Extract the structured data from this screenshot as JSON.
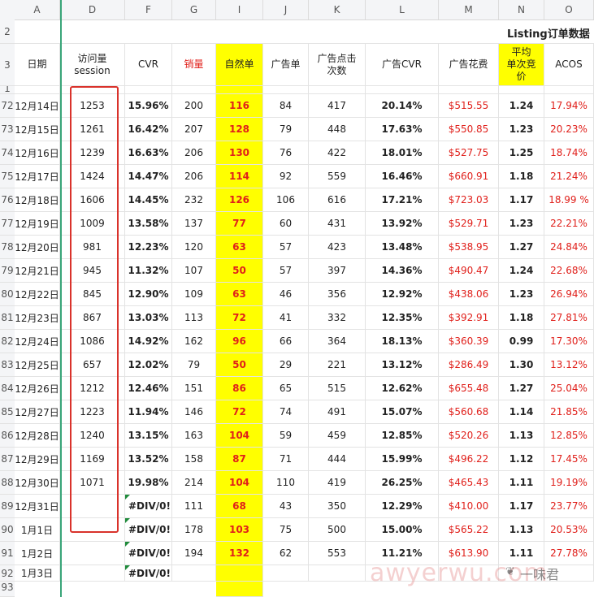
{
  "columns": [
    "A",
    "D",
    "F",
    "G",
    "I",
    "J",
    "K",
    "L",
    "M",
    "N",
    "O"
  ],
  "title_row": {
    "row_no": "2",
    "text": "Listing订单数据"
  },
  "header_row": {
    "row_no": "3",
    "labels": [
      "日期",
      "访问量\nsession",
      "CVR",
      "销量",
      "自然单",
      "广告单",
      "广告点击\n次数",
      "广告CVR",
      "广告花费",
      "平均\n单次竞\n价",
      "ACOS"
    ]
  },
  "partial_row_no": "1",
  "rows": [
    {
      "n": "72",
      "date": "12月14日",
      "session": "1253",
      "cvr": "15.96%",
      "sales": "200",
      "organic": "116",
      "ad_orders": "84",
      "ad_clicks": "417",
      "ad_cvr": "20.14%",
      "ad_spend": "$515.55",
      "cpc": "1.24",
      "acos": "17.94%"
    },
    {
      "n": "73",
      "date": "12月15日",
      "session": "1261",
      "cvr": "16.42%",
      "sales": "207",
      "organic": "128",
      "ad_orders": "79",
      "ad_clicks": "448",
      "ad_cvr": "17.63%",
      "ad_spend": "$550.85",
      "cpc": "1.23",
      "acos": "20.23%"
    },
    {
      "n": "74",
      "date": "12月16日",
      "session": "1239",
      "cvr": "16.63%",
      "sales": "206",
      "organic": "130",
      "ad_orders": "76",
      "ad_clicks": "422",
      "ad_cvr": "18.01%",
      "ad_spend": "$527.75",
      "cpc": "1.25",
      "acos": "18.74%"
    },
    {
      "n": "75",
      "date": "12月17日",
      "session": "1424",
      "cvr": "14.47%",
      "sales": "206",
      "organic": "114",
      "ad_orders": "92",
      "ad_clicks": "559",
      "ad_cvr": "16.46%",
      "ad_spend": "$660.91",
      "cpc": "1.18",
      "acos": "21.24%"
    },
    {
      "n": "76",
      "date": "12月18日",
      "session": "1606",
      "cvr": "14.45%",
      "sales": "232",
      "organic": "126",
      "ad_orders": "106",
      "ad_clicks": "616",
      "ad_cvr": "17.21%",
      "ad_spend": "$723.03",
      "cpc": "1.17",
      "acos": "18.99 %"
    },
    {
      "n": "77",
      "date": "12月19日",
      "session": "1009",
      "cvr": "13.58%",
      "sales": "137",
      "organic": "77",
      "ad_orders": "60",
      "ad_clicks": "431",
      "ad_cvr": "13.92%",
      "ad_spend": "$529.71",
      "cpc": "1.23",
      "acos": "22.21%"
    },
    {
      "n": "78",
      "date": "12月20日",
      "session": "981",
      "cvr": "12.23%",
      "sales": "120",
      "organic": "63",
      "ad_orders": "57",
      "ad_clicks": "423",
      "ad_cvr": "13.48%",
      "ad_spend": "$538.95",
      "cpc": "1.27",
      "acos": "24.84%"
    },
    {
      "n": "79",
      "date": "12月21日",
      "session": "945",
      "cvr": "11.32%",
      "sales": "107",
      "organic": "50",
      "ad_orders": "57",
      "ad_clicks": "397",
      "ad_cvr": "14.36%",
      "ad_spend": "$490.47",
      "cpc": "1.24",
      "acos": "22.68%"
    },
    {
      "n": "80",
      "date": "12月22日",
      "session": "845",
      "cvr": "12.90%",
      "sales": "109",
      "organic": "63",
      "ad_orders": "46",
      "ad_clicks": "356",
      "ad_cvr": "12.92%",
      "ad_spend": "$438.06",
      "cpc": "1.23",
      "acos": "26.94%"
    },
    {
      "n": "81",
      "date": "12月23日",
      "session": "867",
      "cvr": "13.03%",
      "sales": "113",
      "organic": "72",
      "ad_orders": "41",
      "ad_clicks": "332",
      "ad_cvr": "12.35%",
      "ad_spend": "$392.91",
      "cpc": "1.18",
      "acos": "27.81%"
    },
    {
      "n": "82",
      "date": "12月24日",
      "session": "1086",
      "cvr": "14.92%",
      "sales": "162",
      "organic": "96",
      "ad_orders": "66",
      "ad_clicks": "364",
      "ad_cvr": "18.13%",
      "ad_spend": "$360.39",
      "cpc": "0.99",
      "acos": "17.30%"
    },
    {
      "n": "83",
      "date": "12月25日",
      "session": "657",
      "cvr": "12.02%",
      "sales": "79",
      "organic": "50",
      "ad_orders": "29",
      "ad_clicks": "221",
      "ad_cvr": "13.12%",
      "ad_spend": "$286.49",
      "cpc": "1.30",
      "acos": "13.12%"
    },
    {
      "n": "84",
      "date": "12月26日",
      "session": "1212",
      "cvr": "12.46%",
      "sales": "151",
      "organic": "86",
      "ad_orders": "65",
      "ad_clicks": "515",
      "ad_cvr": "12.62%",
      "ad_spend": "$655.48",
      "cpc": "1.27",
      "acos": "25.04%"
    },
    {
      "n": "85",
      "date": "12月27日",
      "session": "1223",
      "cvr": "11.94%",
      "sales": "146",
      "organic": "72",
      "ad_orders": "74",
      "ad_clicks": "491",
      "ad_cvr": "15.07%",
      "ad_spend": "$560.68",
      "cpc": "1.14",
      "acos": "21.85%"
    },
    {
      "n": "86",
      "date": "12月28日",
      "session": "1240",
      "cvr": "13.15%",
      "sales": "163",
      "organic": "104",
      "ad_orders": "59",
      "ad_clicks": "459",
      "ad_cvr": "12.85%",
      "ad_spend": "$520.26",
      "cpc": "1.13",
      "acos": "12.85%"
    },
    {
      "n": "87",
      "date": "12月29日",
      "session": "1169",
      "cvr": "13.52%",
      "sales": "158",
      "organic": "87",
      "ad_orders": "71",
      "ad_clicks": "444",
      "ad_cvr": "15.99%",
      "ad_spend": "$496.22",
      "cpc": "1.12",
      "acos": "17.45%"
    },
    {
      "n": "88",
      "date": "12月30日",
      "session": "1071",
      "cvr": "19.98%",
      "sales": "214",
      "organic": "104",
      "ad_orders": "110",
      "ad_clicks": "419",
      "ad_cvr": "26.25%",
      "ad_spend": "$465.43",
      "cpc": "1.11",
      "acos": "19.19%"
    },
    {
      "n": "89",
      "date": "12月31日",
      "session": "",
      "cvr": "#DIV/0!",
      "sales": "111",
      "organic": "68",
      "ad_orders": "43",
      "ad_clicks": "350",
      "ad_cvr": "12.29%",
      "ad_spend": "$410.00",
      "cpc": "1.17",
      "acos": "23.77%"
    },
    {
      "n": "90",
      "date": "1月1日",
      "session": "",
      "cvr": "#DIV/0!",
      "sales": "178",
      "organic": "103",
      "ad_orders": "75",
      "ad_clicks": "500",
      "ad_cvr": "15.00%",
      "ad_spend": "$565.22",
      "cpc": "1.13",
      "acos": "20.53%"
    },
    {
      "n": "91",
      "date": "1月2日",
      "session": "",
      "cvr": "#DIV/0!",
      "sales": "194",
      "organic": "132",
      "ad_orders": "62",
      "ad_clicks": "553",
      "ad_cvr": "11.21%",
      "ad_spend": "$613.90",
      "cpc": "1.11",
      "acos": "27.78%"
    },
    {
      "n": "92",
      "date": "1月3日",
      "session": "",
      "cvr": "#DIV/0!",
      "sales": "",
      "organic": "",
      "ad_orders": "",
      "ad_clicks": "",
      "ad_cvr": "",
      "ad_spend": "",
      "cpc": "",
      "acos": ""
    }
  ],
  "last_row_no": "93",
  "watermark": {
    "text": "awyerwu.com",
    "name": "一味君"
  },
  "colors": {
    "accent_red": "#e0201b",
    "highlight_yellow": "#ffff00",
    "freeze_green": "#3aa579",
    "selection_red": "#d9322b"
  }
}
